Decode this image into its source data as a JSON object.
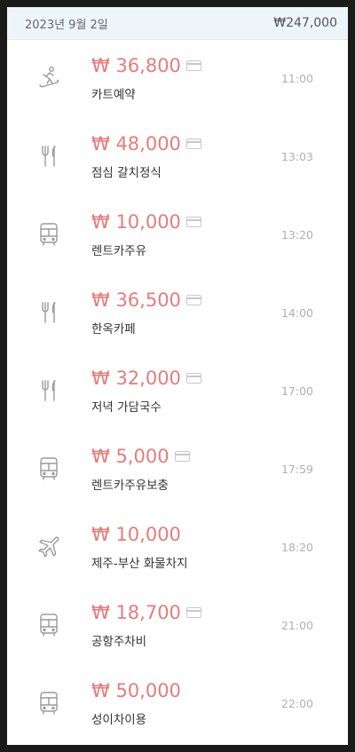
{
  "header": {
    "date": "2023년 9월 2일",
    "total": "₩247,000"
  },
  "colors": {
    "amount": "#e57d7b",
    "header_bg": "#eef5f9",
    "icon_gray": "#9a9a9a"
  },
  "expenses": [
    {
      "icon": "snowboard-icon",
      "amount": "₩ 36,800",
      "card": true,
      "title": "카트예약",
      "time": "11:00"
    },
    {
      "icon": "utensils-icon",
      "amount": "₩ 48,000",
      "card": true,
      "title": "점심 갈치정식",
      "time": "13:03"
    },
    {
      "icon": "bus-icon",
      "amount": "₩ 10,000",
      "card": true,
      "title": "렌트카주유",
      "time": "13:20"
    },
    {
      "icon": "utensils-icon",
      "amount": "₩ 36,500",
      "card": true,
      "title": "한옥카페",
      "time": "14:00"
    },
    {
      "icon": "utensils-icon",
      "amount": "₩ 32,000",
      "card": true,
      "title": "저녁 가담국수",
      "time": "17:00"
    },
    {
      "icon": "bus-icon",
      "amount": "₩ 5,000",
      "card": true,
      "title": "렌트카주유보충",
      "time": "17:59"
    },
    {
      "icon": "airplane-icon",
      "amount": "₩ 10,000",
      "card": false,
      "title": "제주-부산 화물차지",
      "time": "18:20"
    },
    {
      "icon": "bus-icon",
      "amount": "₩ 18,700",
      "card": true,
      "title": "공항주차비",
      "time": "21:00"
    },
    {
      "icon": "bus-icon",
      "amount": "₩ 50,000",
      "card": false,
      "title": "성이차이용",
      "time": "22:00"
    }
  ]
}
